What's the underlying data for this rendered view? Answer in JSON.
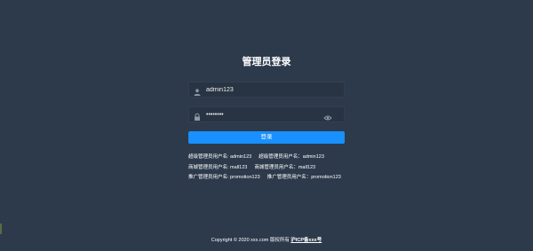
{
  "login": {
    "title": "管理员登录",
    "username": {
      "value": "admin123",
      "placeholder": ""
    },
    "password": {
      "value": "admin123",
      "placeholder": ""
    },
    "submit_label": "登录"
  },
  "tips": [
    {
      "left": "超级管理员用户名: admin123",
      "right": "超级管理员用户名：admin123"
    },
    {
      "left": "商城管理员用户名: mall123",
      "right": "商城管理员用户名：mall123"
    },
    {
      "left": "推广管理员用户名: promotion123",
      "right": "推广管理员用户名：promotion123"
    }
  ],
  "footer": {
    "copyright": "Copyright © 2020 xxx.com 版权所有",
    "icp": "沪ICP备xxx号"
  },
  "colors": {
    "background": "#2d3a4b",
    "input_bg": "#283443",
    "accent": "#1890ff",
    "icon": "#889aa4"
  },
  "icons": {
    "user": "user-icon",
    "lock": "lock-icon",
    "eye": "eye-icon"
  }
}
